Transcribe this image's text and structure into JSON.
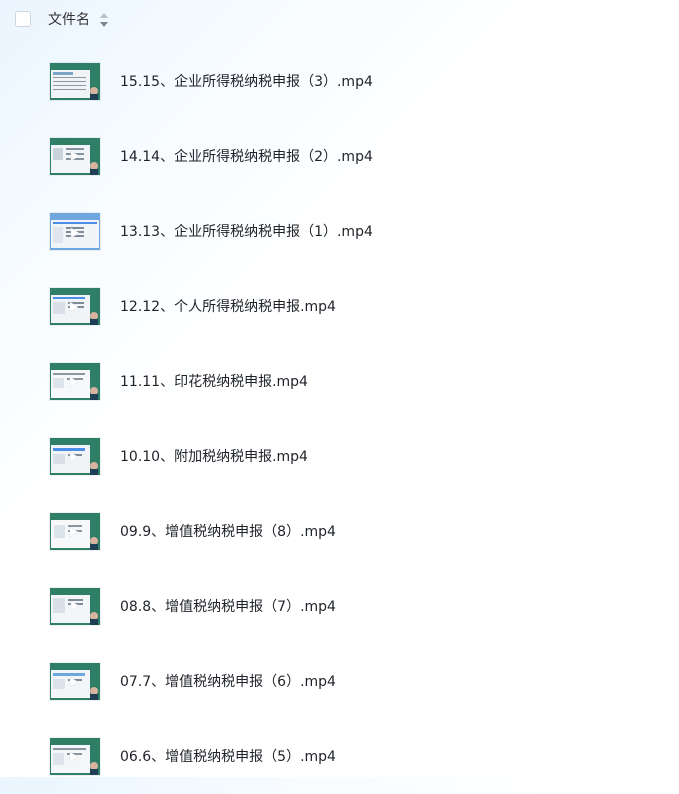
{
  "header": {
    "title": "文件名",
    "sort_icon": "sort-icon"
  },
  "files": [
    {
      "name": "15.15、企业所得税纳税申报（3）.mp4",
      "icon": "video-thumbnail-icon"
    },
    {
      "name": "14.14、企业所得税纳税申报（2）.mp4",
      "icon": "video-thumbnail-icon"
    },
    {
      "name": "13.13、企业所得税纳税申报（1）.mp4",
      "icon": "video-thumbnail-icon"
    },
    {
      "name": "12.12、个人所得税纳税申报.mp4",
      "icon": "video-thumbnail-icon"
    },
    {
      "name": "11.11、印花税纳税申报.mp4",
      "icon": "video-thumbnail-icon"
    },
    {
      "name": "10.10、附加税纳税申报.mp4",
      "icon": "video-thumbnail-icon"
    },
    {
      "name": "09.9、增值税纳税申报（8）.mp4",
      "icon": "video-thumbnail-icon"
    },
    {
      "name": "08.8、增值税纳税申报（7）.mp4",
      "icon": "video-thumbnail-icon"
    },
    {
      "name": "07.7、增值税纳税申报（6）.mp4",
      "icon": "video-thumbnail-icon"
    },
    {
      "name": "06.6、增值税纳税申报（5）.mp4",
      "icon": "video-thumbnail-icon"
    }
  ],
  "colors": {
    "thumbnail_green": "#2f7f67",
    "thumbnail_screen": "#e8edf3",
    "play_icon": "#ffffff",
    "accent_blue": "#4d8ee8"
  }
}
